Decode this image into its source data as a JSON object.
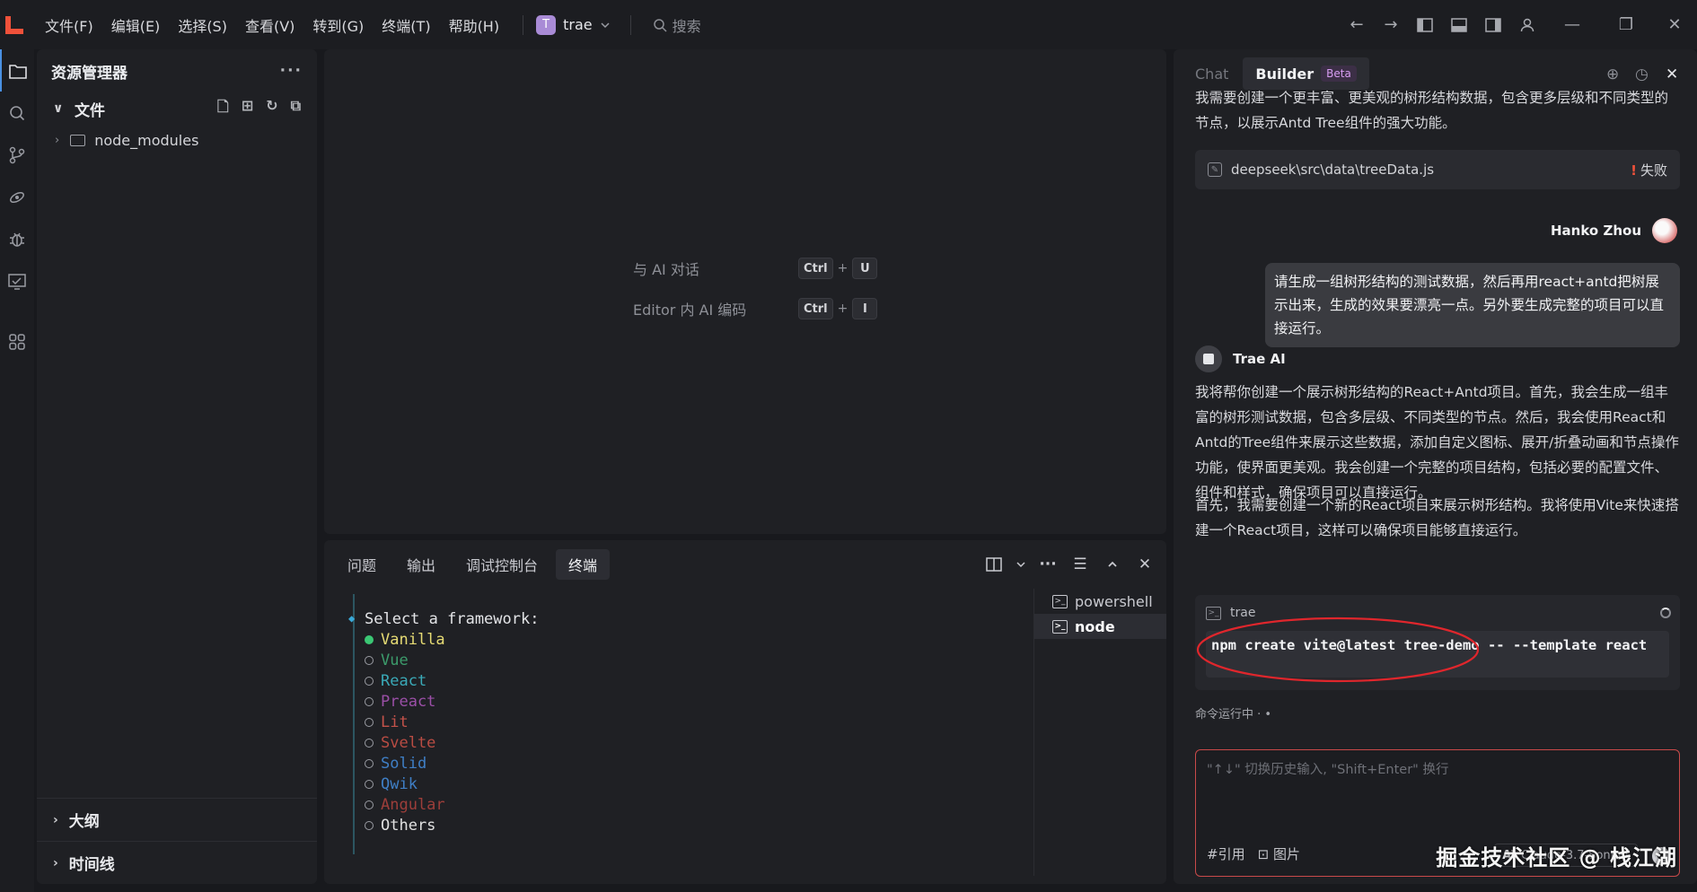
{
  "titlebar": {
    "menus": [
      "文件(F)",
      "编辑(E)",
      "选择(S)",
      "查看(V)",
      "转到(G)",
      "终端(T)",
      "帮助(H)"
    ],
    "project_initial": "T",
    "project_name": "trae",
    "search_placeholder": "搜索"
  },
  "explorer": {
    "title": "资源管理器",
    "section_files": "文件",
    "tree": [
      {
        "name": "node_modules",
        "type": "folder"
      }
    ],
    "section_outline": "大纲",
    "section_timeline": "时间线"
  },
  "editor": {
    "hint_chat_label": "与 AI 对话",
    "hint_chat_keys": [
      "Ctrl",
      "U"
    ],
    "hint_code_label": "Editor 内 AI 编码",
    "hint_code_keys": [
      "Ctrl",
      "I"
    ]
  },
  "panel": {
    "tabs": [
      "问题",
      "输出",
      "调试控制台",
      "终端"
    ],
    "active_tab": "终端",
    "terminal": {
      "prompt": "Select a framework:",
      "options": [
        {
          "label": "Vanilla",
          "color": "#e6db74",
          "selected": true
        },
        {
          "label": "Vue",
          "color": "#3c9b6b",
          "selected": false
        },
        {
          "label": "React",
          "color": "#3aa9b7",
          "selected": false
        },
        {
          "label": "Preact",
          "color": "#9b4fa7",
          "selected": false
        },
        {
          "label": "Lit",
          "color": "#c4524a",
          "selected": false
        },
        {
          "label": "Svelte",
          "color": "#b94c43",
          "selected": false
        },
        {
          "label": "Solid",
          "color": "#3f7fc6",
          "selected": false
        },
        {
          "label": "Qwik",
          "color": "#3f7fc6",
          "selected": false
        },
        {
          "label": "Angular",
          "color": "#9d3e3a",
          "selected": false
        },
        {
          "label": "Others",
          "color": "#e0e0e0",
          "selected": false
        }
      ]
    },
    "terminal_list": [
      {
        "name": "powershell",
        "active": false
      },
      {
        "name": "node",
        "active": true
      }
    ]
  },
  "chat": {
    "tabs": {
      "chat": "Chat",
      "builder": "Builder",
      "beta": "Beta"
    },
    "intro_text": "我需要创建一个更丰富、更美观的树形结构数据，包含更多层级和不同类型的节点，以展示Antd Tree组件的强大功能。",
    "file_card": {
      "path": "deepseek\\src\\data\\treeData.js",
      "status": "失败"
    },
    "user_name": "Hanko Zhou",
    "user_message": "请生成一组树形结构的测试数据，然后再用react+antd把树展示出来，生成的效果要漂亮一点。另外要生成完整的项目可以直接运行。",
    "ai_name": "Trae AI",
    "ai_message_1": "我将帮你创建一个展示树形结构的React+Antd项目。首先，我会生成一组丰富的树形测试数据，包含多层级、不同类型的节点。然后，我会使用React和Antd的Tree组件来展示这些数据，添加自定义图标、展开/折叠动画和节点操作功能，使界面更美观。我会创建一个完整的项目结构，包括必要的配置文件、组件和样式，确保项目可以直接运行。",
    "ai_message_2": "首先，我需要创建一个新的React项目来展示树形结构。我将使用Vite来快速搭建一个React项目，这样可以确保项目能够直接运行。",
    "command_card": {
      "title": "trae",
      "command": "npm create vite@latest tree-demo -- --template react"
    },
    "running_status": "命令运行中 · •",
    "input_placeholder": "\"↑↓\" 切换历史输入, \"Shift+Enter\" 换行",
    "input_reference": "#引用",
    "input_image": "图片",
    "model_name": "Claude-3.7-Sonnet",
    "watermark": "掘金技术社区 @ 栈江湖"
  },
  "colors": {
    "accent": "#4a90e2",
    "logo": "#f0513a",
    "annotation": "#e0262c"
  }
}
